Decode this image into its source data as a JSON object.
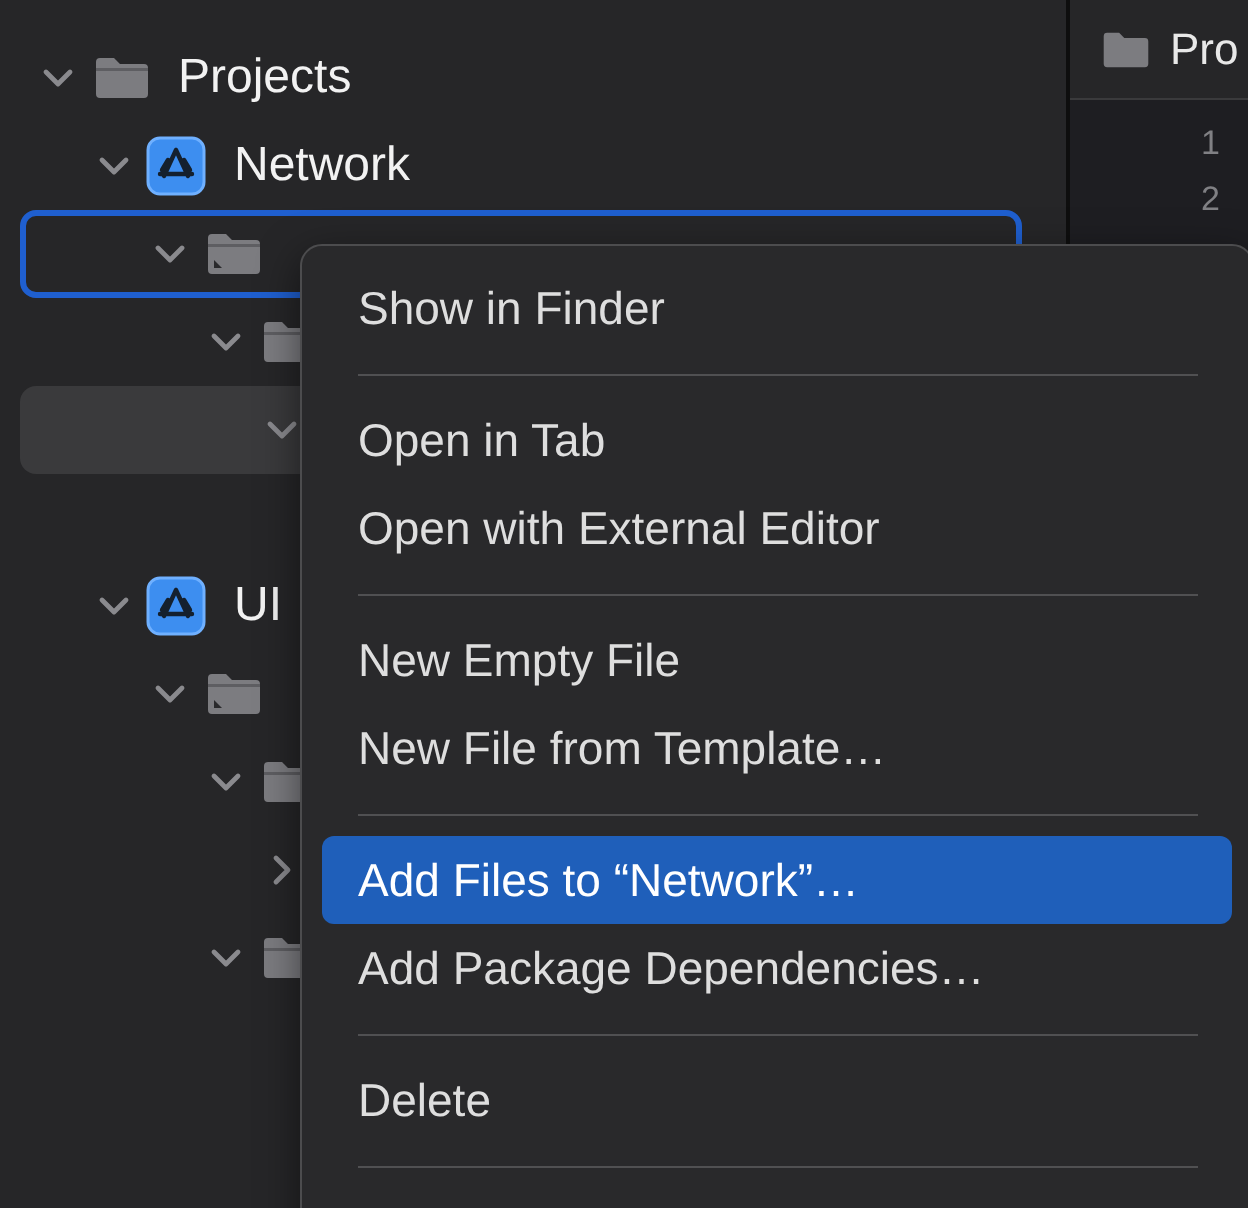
{
  "navigator": {
    "items": [
      {
        "kind": "folder",
        "label": "Projects",
        "expanded": true,
        "selected": false,
        "context_target": false,
        "children": [
          {
            "kind": "project",
            "label": "Network",
            "expanded": true,
            "selected": false,
            "context_target": false,
            "children": [
              {
                "kind": "group",
                "expanded": true,
                "selected": false,
                "context_target": true,
                "children": [
                  {
                    "kind": "folder",
                    "expanded": true,
                    "selected": false,
                    "context_target": false,
                    "children": [
                      {
                        "expanded": true,
                        "selected": true,
                        "context_target": false
                      }
                    ]
                  }
                ]
              }
            ]
          },
          {
            "kind": "project",
            "label": "UI",
            "expanded": true,
            "selected": false,
            "context_target": false,
            "children": [
              {
                "kind": "group",
                "expanded": true,
                "selected": false,
                "context_target": false,
                "children": [
                  {
                    "kind": "folder",
                    "expanded": true,
                    "selected": false,
                    "context_target": false,
                    "children": [
                      {
                        "expanded": false,
                        "selected": false,
                        "context_target": false
                      }
                    ]
                  },
                  {
                    "kind": "folder",
                    "expanded": true,
                    "selected": false,
                    "context_target": false
                  }
                ]
              }
            ]
          }
        ]
      }
    ]
  },
  "editor": {
    "tab": {
      "label": "Pro"
    },
    "line_numbers": [
      "1",
      "2"
    ]
  },
  "context_menu": {
    "groups": [
      [
        {
          "label": "Show in Finder",
          "selected": false
        }
      ],
      [
        {
          "label": "Open in Tab",
          "selected": false
        },
        {
          "label": "Open with External Editor",
          "selected": false
        }
      ],
      [
        {
          "label": "New Empty File",
          "selected": false
        },
        {
          "label": "New File from Template…",
          "selected": false
        }
      ],
      [
        {
          "label": "Add Files to “Network”…",
          "selected": true
        },
        {
          "label": "Add Package Dependencies…",
          "selected": false
        }
      ],
      [
        {
          "label": "Delete",
          "selected": false
        }
      ]
    ]
  }
}
